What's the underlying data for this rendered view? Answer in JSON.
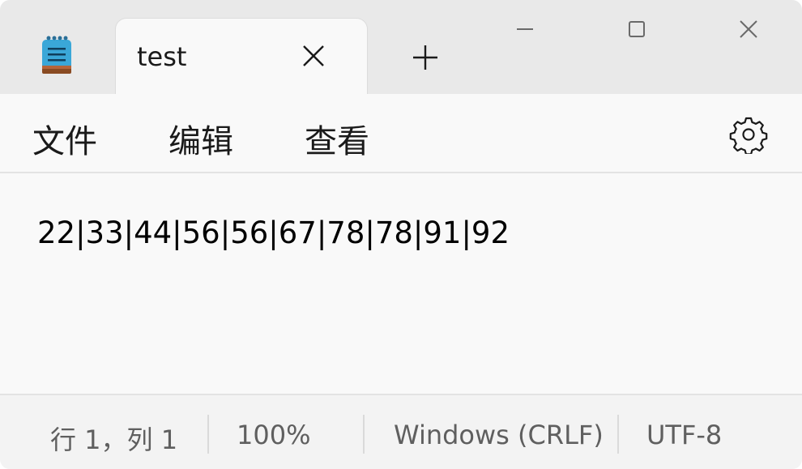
{
  "titlebar": {
    "app_icon": "notepad-icon",
    "tab_title": "test",
    "tab_close_icon": "close-icon",
    "new_tab_icon": "plus-icon",
    "window_controls": [
      "minimize-icon",
      "maximize-icon",
      "close-icon"
    ]
  },
  "menu": {
    "items": [
      {
        "label": "文件"
      },
      {
        "label": "编辑"
      },
      {
        "label": "查看"
      }
    ],
    "settings_icon": "gear-icon"
  },
  "editor": {
    "content": "22|33|44|56|56|67|78|78|91|92"
  },
  "status": {
    "position": "行 1，列 1",
    "zoom": "100%",
    "line_ending": "Windows (CRLF)",
    "encoding": "UTF-8"
  },
  "colors": {
    "titlebar_bg": "#e9e9e9",
    "content_bg": "#f9f9f9",
    "statusbar_bg": "#f3f3f3",
    "icon_blue": "#3aa7d8",
    "icon_brown": "#8a4b22"
  }
}
